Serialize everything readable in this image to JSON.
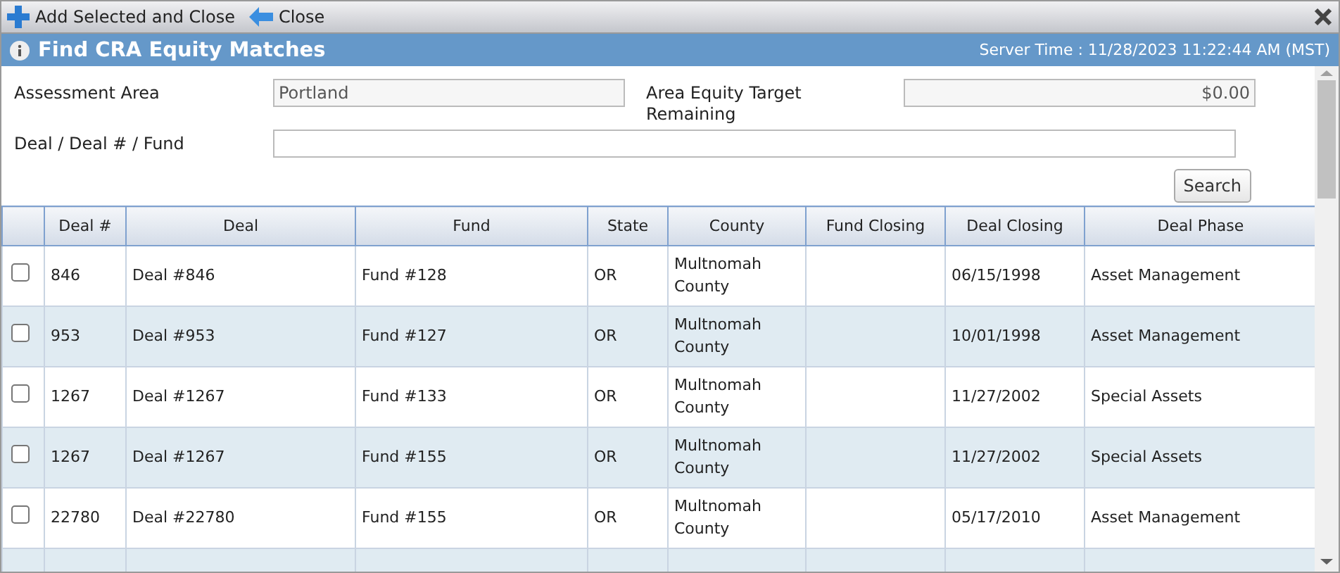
{
  "toolbar": {
    "buttons": [
      {
        "kind": "add",
        "label": "Add Selected and Close"
      },
      {
        "kind": "back",
        "label": "Close"
      }
    ]
  },
  "header": {
    "title": "Find CRA Equity Matches",
    "server_time": "Server Time : 11/28/2023 11:22:44 AM (MST)"
  },
  "form": {
    "assessment_area": {
      "label": "Assessment Area",
      "value": "Portland"
    },
    "equity_target": {
      "label": "Area Equity Target Remaining",
      "value": "$0.00"
    },
    "deal_search": {
      "label": "Deal / Deal # / Fund"
    },
    "search_button": "Search"
  },
  "table": {
    "columns": [
      "Deal #",
      "Deal",
      "Fund",
      "State",
      "County",
      "Fund Closing",
      "Deal Closing",
      "Deal Phase"
    ],
    "rows": [
      {
        "checked": false,
        "cells": [
          "846",
          "Deal #846",
          "Fund #128",
          "OR",
          "Multnomah County",
          "",
          "06/15/1998",
          "Asset Management"
        ]
      },
      {
        "checked": false,
        "cells": [
          "953",
          "Deal #953",
          "Fund #127",
          "OR",
          "Multnomah County",
          "",
          "10/01/1998",
          "Asset Management"
        ]
      },
      {
        "checked": false,
        "cells": [
          "1267",
          "Deal #1267",
          "Fund #133",
          "OR",
          "Multnomah County",
          "",
          "11/27/2002",
          "Special Assets"
        ]
      },
      {
        "checked": false,
        "cells": [
          "1267",
          "Deal #1267",
          "Fund #155",
          "OR",
          "Multnomah County",
          "",
          "11/27/2002",
          "Special Assets"
        ]
      },
      {
        "checked": false,
        "cells": [
          "22780",
          "Deal #22780",
          "Fund #155",
          "OR",
          "Multnomah County",
          "",
          "05/17/2010",
          "Asset Management"
        ]
      }
    ]
  }
}
